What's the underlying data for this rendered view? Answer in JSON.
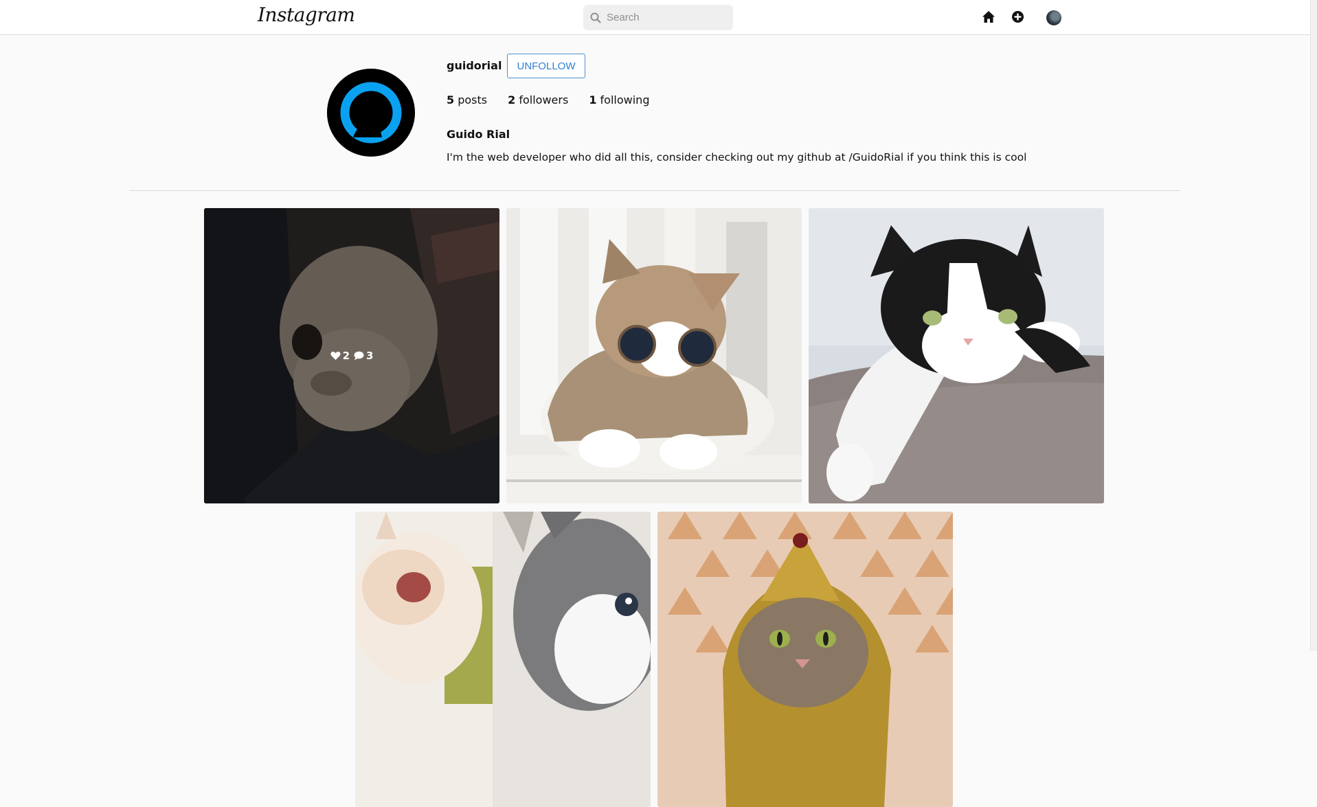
{
  "navbar": {
    "logo_text": "Instagram",
    "search_placeholder": "Search",
    "icons": [
      "home-icon",
      "add-post-icon",
      "user-avatar-icon"
    ]
  },
  "profile": {
    "username": "guidorial",
    "follow_button_label": "UNFOLLOW",
    "posts_count": "5",
    "posts_label": "posts",
    "followers_count": "2",
    "followers_label": "followers",
    "following_count": "1",
    "following_label": "following",
    "full_name": "Guido Rial",
    "bio": "I'm the web developer who did all this, consider checking out my github at /GuidoRial if you think this is cool"
  },
  "posts": [
    {
      "subject": "fluffy cat in dark blanket",
      "likes": "2",
      "comments": "3",
      "hovered": true
    },
    {
      "subject": "tabby cat with sunglasses",
      "hovered": false
    },
    {
      "subject": "black and white cat on couch",
      "hovered": false
    },
    {
      "subject": "two kittens collage",
      "hovered": false
    },
    {
      "subject": "cat in pharaoh costume",
      "hovered": false
    }
  ],
  "colors": {
    "accent_blue": "#2f7fcf",
    "avatar_ring": "#0aa2f0",
    "border": "#dbdbdb",
    "background": "#fafafa"
  }
}
